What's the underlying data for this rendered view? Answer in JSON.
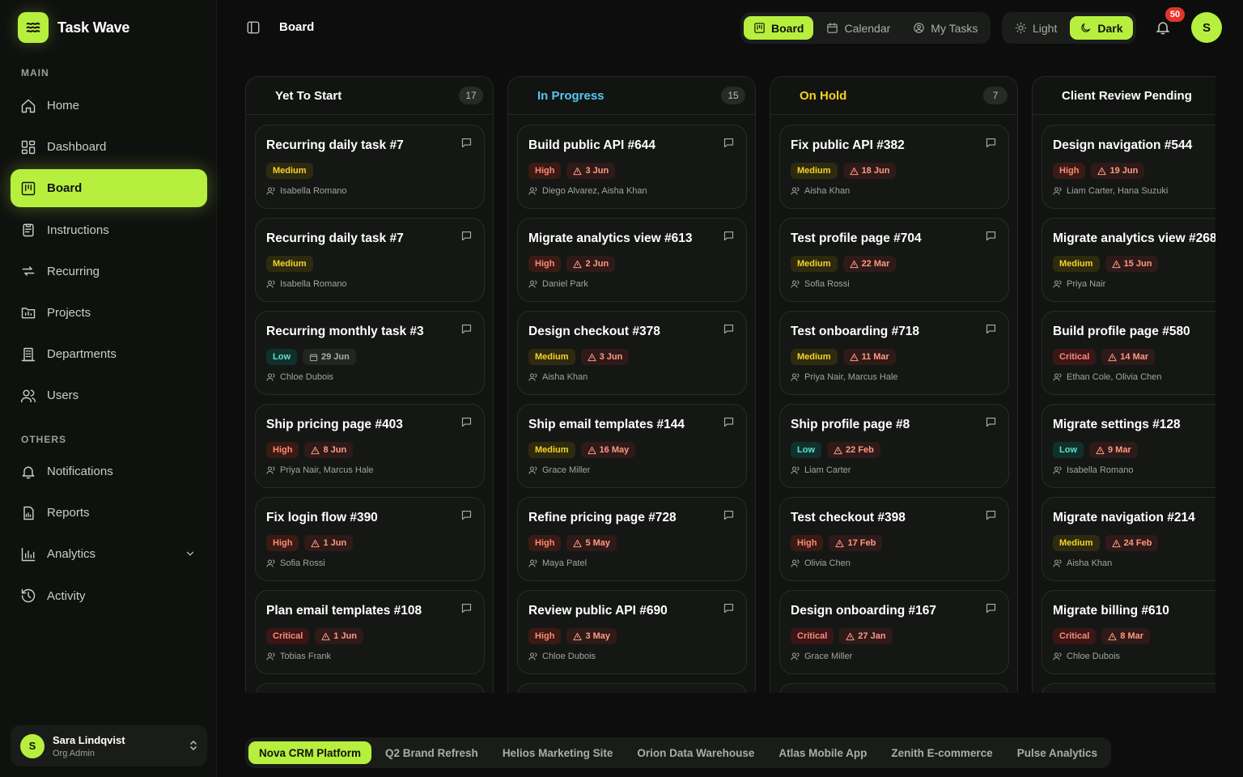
{
  "app": {
    "name": "Task Wave"
  },
  "sidebar": {
    "main_label": "MAIN",
    "others_label": "OTHERS",
    "main_items": [
      {
        "label": "Home",
        "icon": "home-icon"
      },
      {
        "label": "Dashboard",
        "icon": "dashboard-icon"
      },
      {
        "label": "Board",
        "icon": "board-icon",
        "active": true
      },
      {
        "label": "Instructions",
        "icon": "clipboard-icon"
      },
      {
        "label": "Recurring",
        "icon": "repeat-icon"
      },
      {
        "label": "Projects",
        "icon": "projects-icon"
      },
      {
        "label": "Departments",
        "icon": "building-icon"
      },
      {
        "label": "Users",
        "icon": "users-icon"
      }
    ],
    "other_items": [
      {
        "label": "Notifications",
        "icon": "bell-icon"
      },
      {
        "label": "Reports",
        "icon": "report-icon"
      },
      {
        "label": "Analytics",
        "icon": "bar-chart-icon",
        "expandable": true
      },
      {
        "label": "Activity",
        "icon": "history-icon"
      }
    ],
    "user": {
      "initial": "S",
      "name": "Sara Lindqvist",
      "role": "Org Admin"
    }
  },
  "header": {
    "title": "Board",
    "views": [
      {
        "label": "Board",
        "icon": "board-icon",
        "active": true
      },
      {
        "label": "Calendar",
        "icon": "calendar-icon"
      },
      {
        "label": "My Tasks",
        "icon": "user-circle-icon"
      }
    ],
    "themes": [
      {
        "label": "Light",
        "icon": "sun-icon"
      },
      {
        "label": "Dark",
        "icon": "moon-icon",
        "active": true
      }
    ],
    "notification_count": "50",
    "avatar_initial": "S"
  },
  "colors": {
    "accent": "#b7ef3e",
    "yet_to_start": "#ffffff",
    "in_progress": "#56c8f2",
    "on_hold": "#f5d21f",
    "client_review": "#ffffff"
  },
  "columns": [
    {
      "title": "Yet To Start",
      "count": "17",
      "color": "#ffffff",
      "cards": [
        {
          "title": "Recurring daily task #7",
          "priority": "Medium",
          "date": "",
          "assignees": "Isabella Romano"
        },
        {
          "title": "Recurring daily task #7",
          "priority": "Medium",
          "date": "",
          "assignees": "Isabella Romano"
        },
        {
          "title": "Recurring monthly task #3",
          "priority": "Low",
          "date": "29 Jun",
          "date_style": "plain",
          "assignees": "Chloe Dubois"
        },
        {
          "title": "Ship pricing page #403",
          "priority": "High",
          "date": "8 Jun",
          "assignees": "Priya Nair, Marcus Hale"
        },
        {
          "title": "Fix login flow #390",
          "priority": "High",
          "date": "1 Jun",
          "assignees": "Sofia Rossi"
        },
        {
          "title": "Plan email templates #108",
          "priority": "Critical",
          "date": "1 Jun",
          "assignees": "Tobias Frank"
        }
      ]
    },
    {
      "title": "In Progress",
      "count": "15",
      "color": "#56c8f2",
      "cards": [
        {
          "title": "Build public API #644",
          "priority": "High",
          "date": "3 Jun",
          "assignees": "Diego Alvarez, Aisha Khan"
        },
        {
          "title": "Migrate analytics view #613",
          "priority": "High",
          "date": "2 Jun",
          "assignees": "Daniel Park"
        },
        {
          "title": "Design checkout #378",
          "priority": "Medium",
          "date": "3 Jun",
          "assignees": "Aisha Khan"
        },
        {
          "title": "Ship email templates #144",
          "priority": "Medium",
          "date": "16 May",
          "assignees": "Grace Miller"
        },
        {
          "title": "Refine pricing page #728",
          "priority": "High",
          "date": "5 May",
          "assignees": "Maya Patel"
        },
        {
          "title": "Review public API #690",
          "priority": "High",
          "date": "3 May",
          "assignees": "Chloe Dubois"
        }
      ]
    },
    {
      "title": "On Hold",
      "count": "7",
      "color": "#f5d21f",
      "cards": [
        {
          "title": "Fix public API #382",
          "priority": "Medium",
          "date": "18 Jun",
          "assignees": "Aisha Khan"
        },
        {
          "title": "Test profile page #704",
          "priority": "Medium",
          "date": "22 Mar",
          "assignees": "Sofia Rossi"
        },
        {
          "title": "Test onboarding #718",
          "priority": "Medium",
          "date": "11 Mar",
          "assignees": "Priya Nair, Marcus Hale"
        },
        {
          "title": "Ship profile page #8",
          "priority": "Low",
          "date": "22 Feb",
          "assignees": "Liam Carter"
        },
        {
          "title": "Test checkout #398",
          "priority": "High",
          "date": "17 Feb",
          "assignees": "Olivia Chen"
        },
        {
          "title": "Design onboarding #167",
          "priority": "Critical",
          "date": "27 Jan",
          "assignees": "Grace Miller"
        }
      ]
    },
    {
      "title": "Client Review Pending",
      "count": "",
      "color": "#ffffff",
      "cards": [
        {
          "title": "Design navigation #544",
          "priority": "High",
          "date": "19 Jun",
          "assignees": "Liam Carter, Hana Suzuki"
        },
        {
          "title": "Migrate analytics view #268",
          "priority": "Medium",
          "date": "15 Jun",
          "assignees": "Priya Nair"
        },
        {
          "title": "Build profile page #580",
          "priority": "Critical",
          "date": "14 Mar",
          "assignees": "Ethan Cole, Olivia Chen"
        },
        {
          "title": "Migrate settings #128",
          "priority": "Low",
          "date": "9 Mar",
          "assignees": "Isabella Romano"
        },
        {
          "title": "Migrate navigation #214",
          "priority": "Medium",
          "date": "24 Feb",
          "assignees": "Aisha Khan"
        },
        {
          "title": "Migrate billing #610",
          "priority": "Critical",
          "date": "8 Mar",
          "assignees": "Chloe Dubois"
        }
      ]
    }
  ],
  "projects": [
    {
      "label": "Nova CRM Platform",
      "active": true
    },
    {
      "label": "Q2 Brand Refresh"
    },
    {
      "label": "Helios Marketing Site"
    },
    {
      "label": "Orion Data Warehouse"
    },
    {
      "label": "Atlas Mobile App"
    },
    {
      "label": "Zenith E-commerce"
    },
    {
      "label": "Pulse Analytics"
    }
  ]
}
